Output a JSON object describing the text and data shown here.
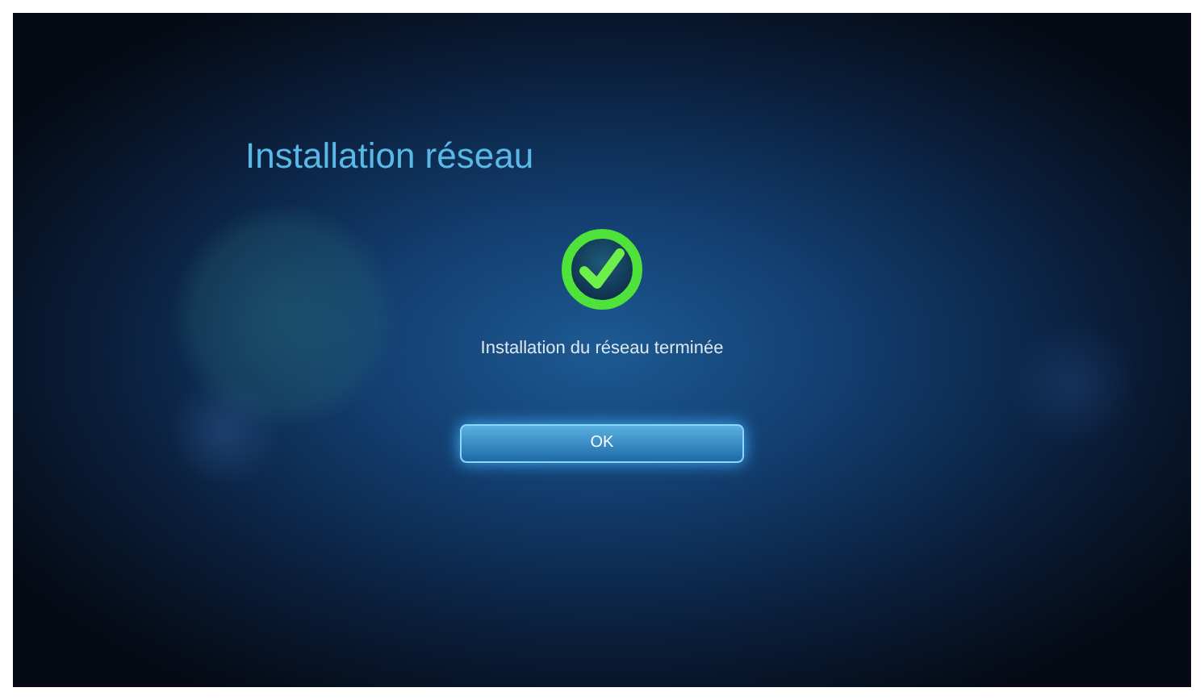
{
  "screen": {
    "title": "Installation réseau"
  },
  "dialog": {
    "completed": true,
    "message": "Installation du réseau terminée"
  },
  "buttons": [
    {
      "label": "OK",
      "selected": true
    }
  ]
}
